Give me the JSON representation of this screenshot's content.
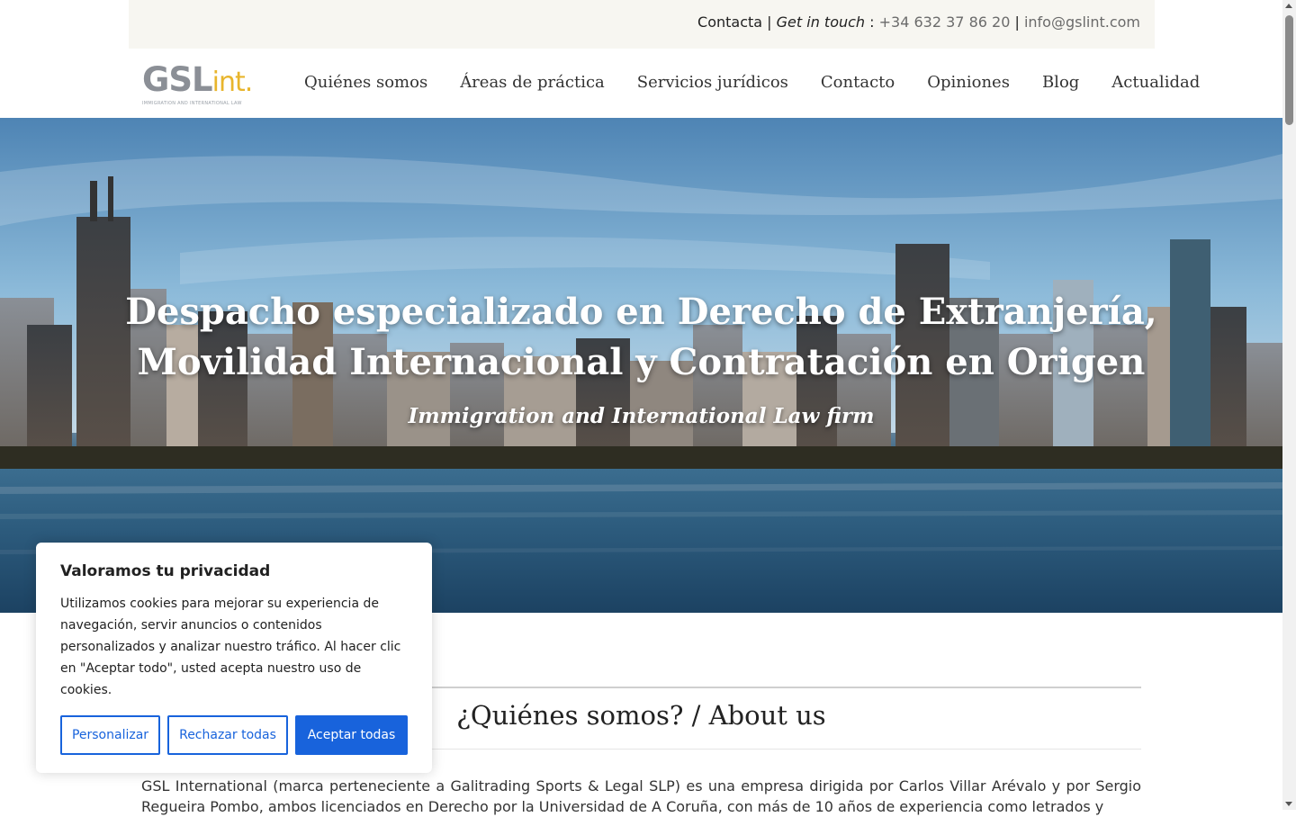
{
  "topbar": {
    "contact_label": "Contacta",
    "separator1": " | ",
    "get_in_touch": "Get in touch",
    "colon": " : ",
    "phone": "+34 632 37 86 20",
    "separator2": " | ",
    "email": "info@gslint.com"
  },
  "logo": {
    "main": "GSL",
    "suffix": "int.",
    "tagline": "IMMIGRATION AND INTERNATIONAL LAW"
  },
  "nav": {
    "items": [
      {
        "label": "Quiénes somos"
      },
      {
        "label": "Áreas de práctica"
      },
      {
        "label": "Servicios jurídicos"
      },
      {
        "label": "Contacto"
      },
      {
        "label": "Opiniones"
      },
      {
        "label": "Blog"
      },
      {
        "label": "Actualidad"
      }
    ]
  },
  "hero": {
    "title_line1": "Despacho especializado en Derecho de Extranjería,",
    "title_line2": "Movilidad Internacional y Contratación en Origen",
    "subtitle": "Immigration and International Law firm"
  },
  "about": {
    "title": "¿Quiénes somos? / About us",
    "text": "GSL International (marca perteneciente a Galitrading Sports & Legal SLP) es una empresa dirigida por Carlos Villar Arévalo y por Sergio Regueira Pombo, ambos licenciados en Derecho por la Universidad de A Coruña, con más de 10 años de experiencia como letrados y"
  },
  "cookie": {
    "title": "Valoramos tu privacidad",
    "text": "Utilizamos cookies para mejorar su experiencia de navegación, servir anuncios o contenidos personalizados y analizar nuestro tráfico. Al hacer clic en \"Aceptar todo\", usted acepta nuestro uso de cookies.",
    "customize": "Personalizar",
    "reject": "Rechazar todas",
    "accept": "Aceptar todas"
  },
  "colors": {
    "accent": "#1863dc",
    "logo_gray": "#8b8f96",
    "logo_yellow": "#e8b52c",
    "topbar_bg": "#f7f6f1"
  }
}
